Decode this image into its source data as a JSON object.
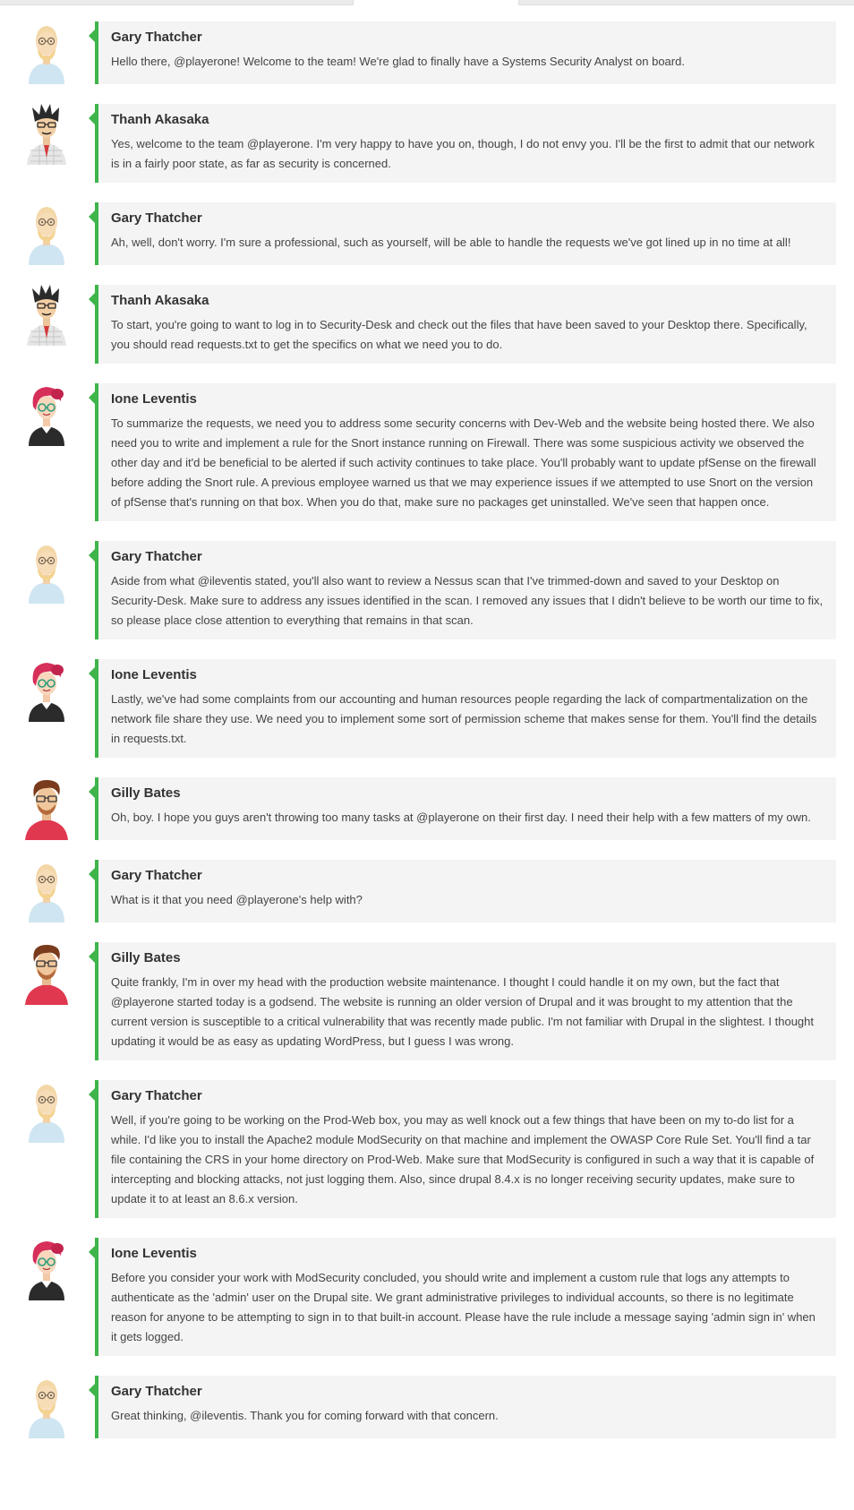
{
  "colors": {
    "accent_border": "#3fb44a",
    "bubble_background": "#f4f4f4",
    "author_text": "#333333",
    "message_text": "#444444"
  },
  "tabs": [
    "",
    "",
    ""
  ],
  "avatars": {
    "gary": "bald-man-glasses-icon",
    "thanh": "man-spiky-hair-icon",
    "ione": "woman-red-hair-glasses-icon",
    "gilly": "man-brown-hair-red-shirt-icon"
  },
  "messages": [
    {
      "author": "Gary Thatcher",
      "avatar": "gary",
      "text": "Hello there, @playerone! Welcome to the team! We're glad to finally have a Systems Security Analyst on board."
    },
    {
      "author": "Thanh Akasaka",
      "avatar": "thanh",
      "text": "Yes, welcome to the team @playerone. I'm very happy to have you on, though, I do not envy you. I'll be the first to admit that our network is in a fairly poor state, as far as security is concerned."
    },
    {
      "author": "Gary Thatcher",
      "avatar": "gary",
      "text": "Ah, well, don't worry. I'm sure a professional, such as yourself, will be able to handle the requests we've got lined up in no time at all!"
    },
    {
      "author": "Thanh Akasaka",
      "avatar": "thanh",
      "text": "To start, you're going to want to log in to Security-Desk and check out the files that have been saved to your Desktop there. Specifically, you should read requests.txt to get the specifics on what we need you to do."
    },
    {
      "author": "Ione Leventis",
      "avatar": "ione",
      "text": "To summarize the requests, we need you to address some security concerns with Dev-Web and the website being hosted there. We also need you to write and implement a rule for the Snort instance running on Firewall. There was some suspicious activity we observed the other day and it'd be beneficial to be alerted if such activity continues to take place. You'll probably want to update pfSense on the firewall before adding the Snort rule. A previous employee warned us that we may experience issues if we attempted to use Snort on the version of pfSense that's running on that box. When you do that, make sure no packages get uninstalled. We've seen that happen once."
    },
    {
      "author": "Gary Thatcher",
      "avatar": "gary",
      "text": "Aside from what @ileventis stated, you'll also want to review a Nessus scan that I've trimmed-down and saved to your Desktop on Security-Desk. Make sure to address any issues identified in the scan. I removed any issues that I didn't believe to be worth our time to fix, so please place close attention to everything that remains in that scan."
    },
    {
      "author": "Ione Leventis",
      "avatar": "ione",
      "text": "Lastly, we've had some complaints from our accounting and human resources people regarding the lack of compartmentalization on the network file share they use. We need you to implement some sort of permission scheme that makes sense for them. You'll find the details in requests.txt."
    },
    {
      "author": "Gilly Bates",
      "avatar": "gilly",
      "text": "Oh, boy. I hope you guys aren't throwing too many tasks at @playerone on their first day. I need their help with a few matters of my own."
    },
    {
      "author": "Gary Thatcher",
      "avatar": "gary",
      "text": "What is it that you need @playerone's help with?"
    },
    {
      "author": "Gilly Bates",
      "avatar": "gilly",
      "text": "Quite frankly, I'm in over my head with the production website maintenance. I thought I could handle it on my own, but the fact that @playerone started today is a godsend. The website is running an older version of Drupal and it was brought to my attention that the current version is susceptible to a critical vulnerability that was recently made public. I'm not familiar with Drupal in the slightest. I thought updating it would be as easy as updating WordPress, but I guess I was wrong."
    },
    {
      "author": "Gary Thatcher",
      "avatar": "gary",
      "text": "Well, if you're going to be working on the Prod-Web box, you may as well knock out a few things that have been on my to-do list for a while. I'd like you to install the Apache2 module ModSecurity on that machine and implement the OWASP Core Rule Set. You'll find a tar file containing the CRS in your home directory on Prod-Web. Make sure that ModSecurity is configured in such a way that it is capable of intercepting and blocking attacks, not just logging them. Also, since drupal 8.4.x is no longer receiving security updates, make sure to update it to at least an 8.6.x version."
    },
    {
      "author": "Ione Leventis",
      "avatar": "ione",
      "text": "Before you consider your work with ModSecurity concluded, you should write and implement a custom rule that logs any attempts to authenticate as the 'admin' user on the Drupal site. We grant administrative privileges to individual accounts, so there is no legitimate reason for anyone to be attempting to sign in to that built-in account. Please have the rule include a message saying 'admin sign in' when it gets logged."
    },
    {
      "author": "Gary Thatcher",
      "avatar": "gary",
      "text": "Great thinking, @ileventis. Thank you for coming forward with that concern."
    }
  ]
}
